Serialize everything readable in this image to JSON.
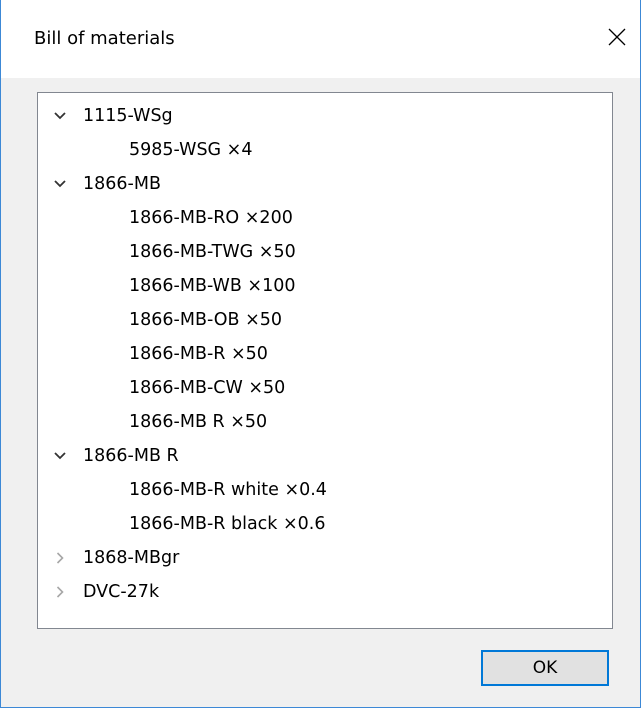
{
  "window": {
    "title": "Bill of materials",
    "close_icon": "close-icon",
    "border_color": "#3c88d6"
  },
  "tree": {
    "items": [
      {
        "label": "1115-WSg",
        "state": "expanded",
        "children": [
          "5985-WSG ×4"
        ]
      },
      {
        "label": "1866-MB",
        "state": "expanded",
        "children": [
          "1866-MB-RO ×200",
          "1866-MB-TWG ×50",
          "1866-MB-WB ×100",
          "1866-MB-OB ×50",
          "1866-MB-R ×50",
          "1866-MB-CW ×50",
          "1866-MB R ×50"
        ]
      },
      {
        "label": "1866-MB R",
        "state": "expanded",
        "children": [
          "1866-MB-R white ×0.4",
          "1866-MB-R black ×0.6"
        ]
      },
      {
        "label": "1868-MBgr",
        "state": "collapsed",
        "children": []
      },
      {
        "label": "DVC-27k",
        "state": "collapsed",
        "children": []
      }
    ]
  },
  "buttons": {
    "ok_label": "OK",
    "ok_accent": "#0078d7"
  }
}
